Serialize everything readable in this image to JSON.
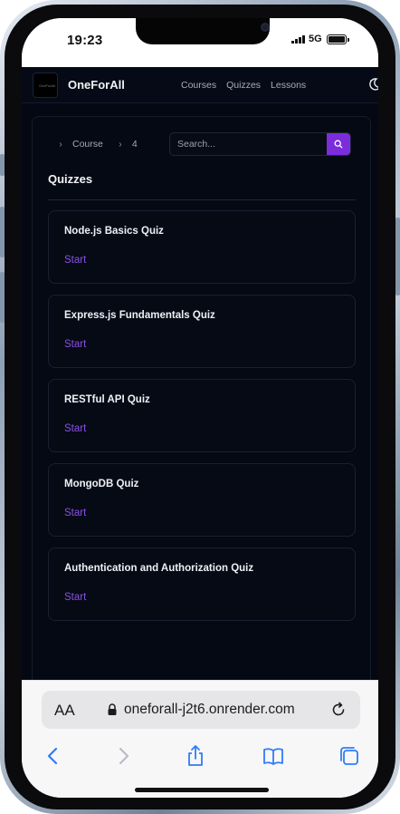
{
  "status_bar": {
    "time": "19:23",
    "network": "5G"
  },
  "nav": {
    "brand": "OneForAll",
    "logo_text": "OneForAll",
    "links": [
      "Courses",
      "Quizzes",
      "Lessons"
    ]
  },
  "breadcrumb": {
    "items": [
      "Course",
      "4"
    ]
  },
  "search": {
    "placeholder": "Search..."
  },
  "section": {
    "title": "Quizzes"
  },
  "quizzes": [
    {
      "title": "Node.js Basics Quiz",
      "action": "Start"
    },
    {
      "title": "Express.js Fundamentals Quiz",
      "action": "Start"
    },
    {
      "title": "RESTful API Quiz",
      "action": "Start"
    },
    {
      "title": "MongoDB Quiz",
      "action": "Start"
    },
    {
      "title": "Authentication and Authorization Quiz",
      "action": "Start"
    }
  ],
  "browser": {
    "text_size_label": "AA",
    "url": "oneforall-j2t6.onrender.com"
  },
  "colors": {
    "accent": "#7b2ddb",
    "link": "#8a4fe6",
    "app_background": "#040812"
  },
  "icons": [
    "search-icon",
    "theme-toggle-icon",
    "lock-icon",
    "reload-icon",
    "back-icon",
    "forward-icon",
    "share-icon",
    "bookmarks-icon",
    "tabs-icon"
  ]
}
